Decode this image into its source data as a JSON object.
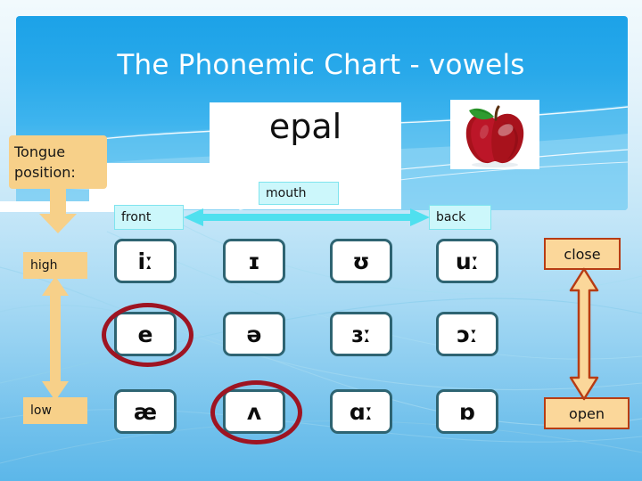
{
  "slide": {
    "title": "The Phonemic Chart - vowels",
    "word_card": "epal",
    "picture_alt": "red-apple"
  },
  "callout": {
    "tongue_label": "Tongue position:"
  },
  "axes": {
    "horizontal": {
      "left_label": "front",
      "center_label": "mouth",
      "right_label": "back"
    },
    "vertical_left": {
      "top_label": "high",
      "bottom_label": "low"
    },
    "vertical_right": {
      "top_label": "close",
      "bottom_label": "open"
    }
  },
  "vowel_grid": {
    "rows": [
      {
        "symbols": [
          "iː",
          "ɪ",
          "ʊ",
          "uː"
        ]
      },
      {
        "symbols": [
          "e",
          "ə",
          "ɜː",
          "ɔː"
        ]
      },
      {
        "symbols": [
          "æ",
          "ʌ",
          "ɑː",
          "ɒ"
        ]
      }
    ],
    "highlighted": [
      "e",
      "ʌ"
    ]
  },
  "colors": {
    "header_blue": "#29a9ea",
    "cell_border": "#2e6472",
    "tan": "#f7d089",
    "tan_border": "#b73c14",
    "cyan": "#ccf7fb",
    "cyan_arrow": "#4fe0ef",
    "highlight_red": "#9e1422",
    "title_text": "#ffffff"
  }
}
